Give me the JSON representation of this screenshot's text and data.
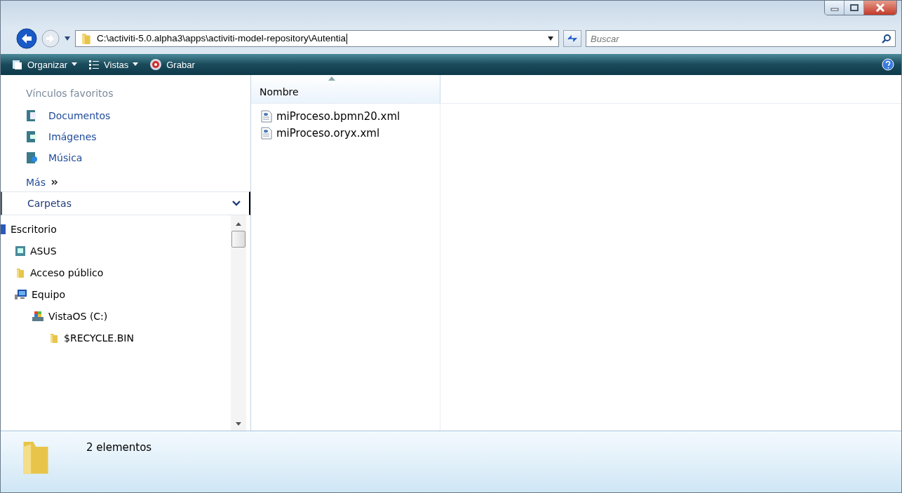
{
  "address_bar": {
    "path": "C:\\activiti-5.0.alpha3\\apps\\activiti-model-repository\\Autentia"
  },
  "search": {
    "placeholder": "Buscar"
  },
  "toolbar": [
    {
      "label": "Organizar",
      "kind": "organize"
    },
    {
      "label": "Vistas",
      "kind": "views"
    },
    {
      "label": "Grabar",
      "kind": "burn"
    }
  ],
  "favorites": {
    "title": "Vínculos favoritos",
    "items": [
      {
        "label": "Documentos",
        "kind": "documents"
      },
      {
        "label": "Imágenes",
        "kind": "pictures"
      },
      {
        "label": "Música",
        "kind": "music"
      }
    ],
    "more": "Más"
  },
  "folders": {
    "title": "Carpetas",
    "tree": [
      {
        "label": "Escritorio",
        "kind": "desktop",
        "children": [
          {
            "label": "ASUS",
            "kind": "user"
          },
          {
            "label": "Acceso público",
            "kind": "folder"
          },
          {
            "label": "Equipo",
            "kind": "computer",
            "children": [
              {
                "label": "VistaOS (C:)",
                "kind": "drive",
                "children": [
                  {
                    "label": "$RECYCLE.BIN",
                    "kind": "folder"
                  }
                ]
              }
            ]
          }
        ]
      }
    ]
  },
  "file_list": {
    "columns": [
      "Nombre"
    ],
    "files": [
      {
        "name": "miProceso.bpmn20.xml"
      },
      {
        "name": "miProceso.oryx.xml"
      }
    ]
  },
  "status_bar": {
    "count": "2 elementos"
  }
}
